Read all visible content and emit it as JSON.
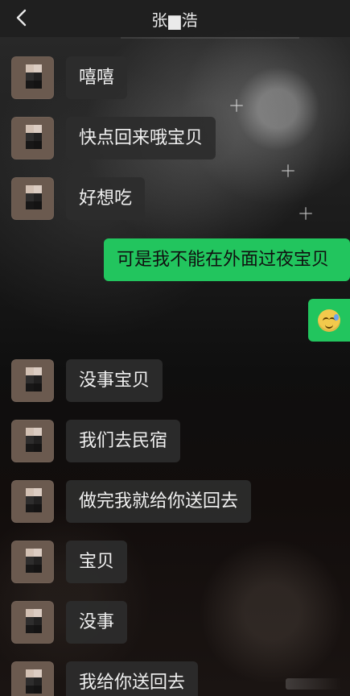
{
  "header": {
    "title": "张▆浩"
  },
  "icons": {
    "back": "chevron-left-icon"
  },
  "messages": [
    {
      "side": "left",
      "text": "嘻嘻"
    },
    {
      "side": "left",
      "text": "快点回来哦宝贝"
    },
    {
      "side": "left",
      "text": "好想吃"
    },
    {
      "side": "right",
      "text": "可是我不能在外面过夜宝贝"
    },
    {
      "side": "right",
      "emoji": "sweat-smile-emoji"
    },
    {
      "side": "left",
      "text": "没事宝贝"
    },
    {
      "side": "left",
      "text": "我们去民宿"
    },
    {
      "side": "left",
      "text": "做完我就给你送回去"
    },
    {
      "side": "left",
      "text": "宝贝"
    },
    {
      "side": "left",
      "text": "没事"
    },
    {
      "side": "left",
      "text": "我给你送回去"
    }
  ],
  "colors": {
    "outgoing_bubble": "#22c55e",
    "incoming_bubble": "#2c2c2c",
    "nav_background": "#1e1e1e"
  }
}
